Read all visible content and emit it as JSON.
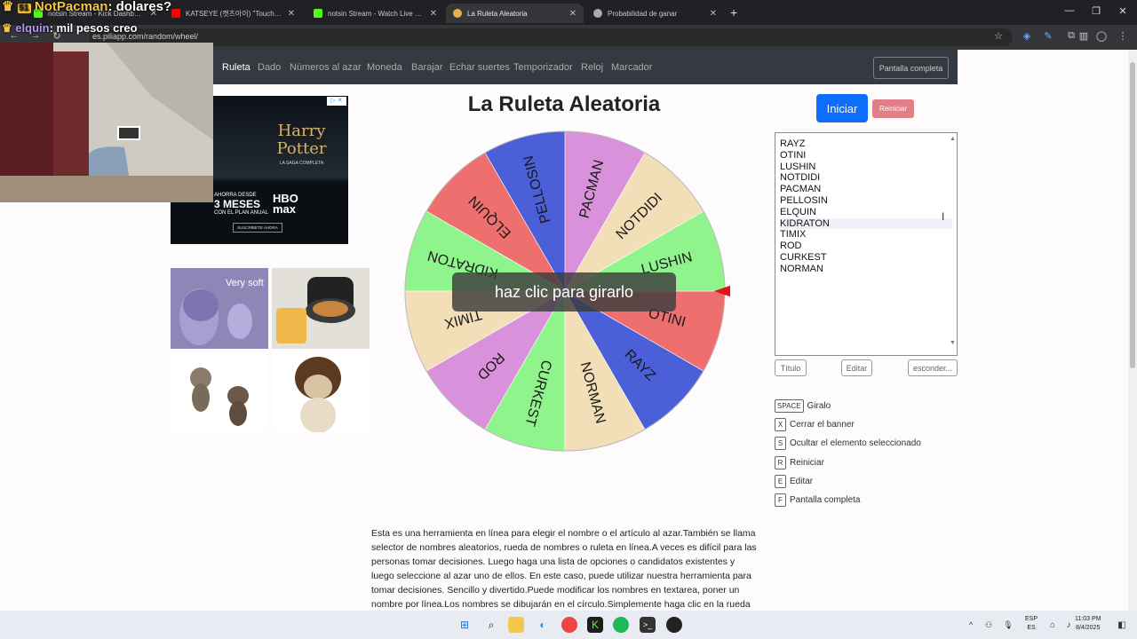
{
  "browser": {
    "tabs": [
      {
        "label": "notsin Stream - Kick Dashboard",
        "favicon_color": "#53fc18"
      },
      {
        "label": "KATSEYE (캣츠아이) \"Touch\" Official",
        "favicon_color": "#ff0000"
      },
      {
        "label": "notsin Stream - Watch Live on Kick",
        "favicon_color": "#53fc18"
      },
      {
        "label": "La Ruleta Aleatoria",
        "favicon_color": "#e8b04a",
        "active": true
      },
      {
        "label": "Probabilidad de ganar",
        "favicon_color": "#aaaaaa"
      }
    ],
    "url": "es.piliapp.com/random/wheel/"
  },
  "stream_overlay": {
    "chat": [
      {
        "user": "NotPacman",
        "badge": "51",
        "message": "dolares?"
      },
      {
        "user": "elquin",
        "message": "mil pesos creo"
      }
    ]
  },
  "nav": {
    "items": [
      "Ruleta",
      "Dado",
      "Números al azar",
      "Moneda",
      "Barajar",
      "Echar suertes",
      "Temporizador",
      "Reloj",
      "Marcador"
    ],
    "active": "Ruleta",
    "fullscreen_label": "Pantalla completa"
  },
  "page_title": "La Ruleta Aleatoria",
  "wheel": {
    "segments": [
      {
        "label": "RAYZ",
        "color": "#4a5fd8"
      },
      {
        "label": "OTINI",
        "color": "#ef6f6f"
      },
      {
        "label": "LUSHIN",
        "color": "#90f48c"
      },
      {
        "label": "NOTDIDI",
        "color": "#f3dfb7"
      },
      {
        "label": "PACMAN",
        "color": "#d991dc"
      },
      {
        "label": "PELLOSIN",
        "color": "#4a5fd8"
      },
      {
        "label": "ELQUIN",
        "color": "#ef6f6f"
      },
      {
        "label": "KIDRATON",
        "color": "#90f48c"
      },
      {
        "label": "TIMIX",
        "color": "#f3dfb7"
      },
      {
        "label": "ROD",
        "color": "#d991dc"
      },
      {
        "label": "CURKEST",
        "color": "#90f48c"
      },
      {
        "label": "NORMAN",
        "color": "#f3dfb7"
      }
    ],
    "spin_prompt": "haz clic para girarlo",
    "pointer_color": "#e01414"
  },
  "controls": {
    "start_label": "Iniciar",
    "reset_label": "Reiniciar",
    "names": [
      "RAYZ",
      "OTINI",
      "LUSHIN",
      "NOTDIDI",
      "PACMAN",
      "PELLOSIN",
      "ELQUIN",
      "KIDRATON",
      "TIMIX",
      "ROD",
      "CURKEST",
      "NORMAN"
    ],
    "title_label": "Título",
    "edit_label": "Editar",
    "hide_label": "esconder..."
  },
  "shortcuts": [
    {
      "key": "SPACE",
      "label": "Giralo"
    },
    {
      "key": "X",
      "label": "Cerrar el banner"
    },
    {
      "key": "S",
      "label": "Ocultar el elemento seleccionado"
    },
    {
      "key": "R",
      "label": "Reiniciar"
    },
    {
      "key": "E",
      "label": "Editar"
    },
    {
      "key": "F",
      "label": "Pantalla completa"
    }
  ],
  "description": "Esta es una herramienta en línea para elegir el nombre o el artículo al azar.También se llama selector de nombres aleatorios, rueda de nombres o ruleta en línea.A veces es difícil para las personas tomar decisiones. Luego haga una lista de opciones o candidatos existentes y luego seleccione al azar uno de ellos. En este caso, puede utilizar nuestra herramienta para tomar decisiones. Sencillo y divertido.Puede modificar los nombres en textarea, poner un nombre por línea.Los nombres se dibujarán en el círculo.Simplemente haga clic en la rueda",
  "ads": {
    "hp_title": "Harry Potter",
    "hp_subtitle": "LA SAGA COMPLETA",
    "hp_offer_prefix": "AHORRA DESDE",
    "hp_offer_big": "3 MESES",
    "hp_offer_suffix": "CON EL PLAN ANUAL",
    "hp_logo_1": "HBO",
    "hp_logo_2": "max",
    "hp_cta": "SUSCRÍBETE AHORA",
    "slides_text": "Very soft"
  },
  "taskbar": {
    "lang": "ESP",
    "lang_sub": "ES",
    "time": "11:03 PM",
    "date": "8/4/2025"
  }
}
